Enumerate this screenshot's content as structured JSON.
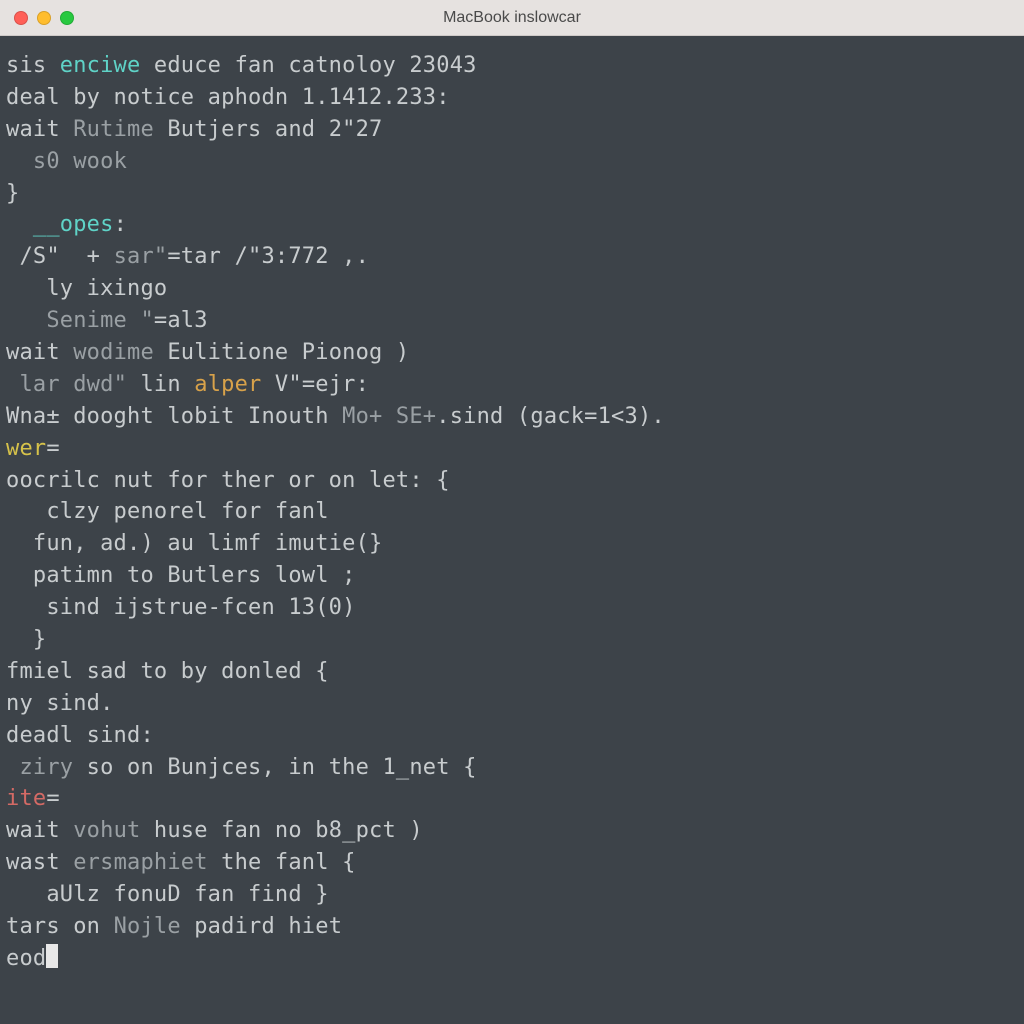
{
  "window": {
    "title": "MacBook inslowcar"
  },
  "terminal": {
    "lines": [
      {
        "indent": 0,
        "spans": [
          {
            "t": "sis ",
            "c": ""
          },
          {
            "t": "enciwe",
            "c": "c-cyan"
          },
          {
            "t": " educe fan catnoloy 23043",
            "c": ""
          }
        ]
      },
      {
        "indent": 0,
        "spans": [
          {
            "t": "deal",
            "c": ""
          },
          {
            "t": " by notice aphodn 1.1412.233:",
            "c": ""
          }
        ]
      },
      {
        "indent": 0,
        "spans": [
          {
            "t": "wait ",
            "c": ""
          },
          {
            "t": "Rutime",
            "c": "c-dim"
          },
          {
            "t": " Butjers and 2\"27",
            "c": ""
          }
        ]
      },
      {
        "indent": 1,
        "spans": [
          {
            "t": "s0 ",
            "c": "c-dim"
          },
          {
            "t": "wook",
            "c": "c-dim"
          }
        ]
      },
      {
        "indent": 0,
        "spans": [
          {
            "t": "}",
            "c": ""
          }
        ]
      },
      {
        "indent": 0,
        "spans": [
          {
            "t": "",
            "c": ""
          }
        ]
      },
      {
        "indent": 1,
        "spans": [
          {
            "t": "__opes",
            "c": "c-cyan"
          },
          {
            "t": ":",
            "c": ""
          }
        ]
      },
      {
        "indent": 0,
        "spans": [
          {
            "t": " /S\"  + ",
            "c": ""
          },
          {
            "t": "sar\"",
            "c": "c-dim"
          },
          {
            "t": "=tar /\"3:772 ,.",
            "c": ""
          }
        ]
      },
      {
        "indent": 1,
        "spans": [
          {
            "t": " ly ixingo",
            "c": ""
          }
        ]
      },
      {
        "indent": 1,
        "spans": [
          {
            "t": " Senime \"",
            "c": "c-dim"
          },
          {
            "t": "=al3",
            "c": ""
          }
        ]
      },
      {
        "indent": 0,
        "spans": [
          {
            "t": "wait ",
            "c": ""
          },
          {
            "t": "wodime",
            "c": "c-dim"
          },
          {
            "t": " Eulitione Pionog )",
            "c": ""
          }
        ]
      },
      {
        "indent": 0,
        "spans": [
          {
            "t": " lar ",
            "c": "c-dim"
          },
          {
            "t": "dwd\"",
            "c": "c-dim"
          },
          {
            "t": " lin ",
            "c": ""
          },
          {
            "t": "alper",
            "c": "c-orange"
          },
          {
            "t": " V\"=ejr:",
            "c": ""
          }
        ]
      },
      {
        "indent": 0,
        "spans": [
          {
            "t": "Wna± dooght lobit Inouth ",
            "c": ""
          },
          {
            "t": "Mo+ SE+",
            "c": "c-dim"
          },
          {
            "t": ".sind (gack=1<3).",
            "c": ""
          }
        ]
      },
      {
        "indent": 0,
        "spans": [
          {
            "t": "",
            "c": ""
          }
        ]
      },
      {
        "indent": 0,
        "spans": [
          {
            "t": "wer",
            "c": "c-yellow"
          },
          {
            "t": "=",
            "c": ""
          }
        ]
      },
      {
        "indent": 0,
        "spans": [
          {
            "t": "oocrilc nut for ther or on let: {",
            "c": ""
          }
        ]
      },
      {
        "indent": 1,
        "spans": [
          {
            "t": " clzy penorel for fanl",
            "c": ""
          }
        ]
      },
      {
        "indent": 1,
        "spans": [
          {
            "t": "fun, ad.) au limf imutie(}",
            "c": ""
          }
        ]
      },
      {
        "indent": 1,
        "spans": [
          {
            "t": "patimn to Butlers lowl ;",
            "c": ""
          }
        ]
      },
      {
        "indent": 1,
        "spans": [
          {
            "t": " sind ijstrue-fcen 13(0)",
            "c": ""
          }
        ]
      },
      {
        "indent": 1,
        "spans": [
          {
            "t": "}",
            "c": ""
          }
        ]
      },
      {
        "indent": 0,
        "spans": [
          {
            "t": "fmiel sad to by donled {",
            "c": ""
          }
        ]
      },
      {
        "indent": 0,
        "spans": [
          {
            "t": "ny sind.",
            "c": ""
          }
        ]
      },
      {
        "indent": 0,
        "spans": [
          {
            "t": "deadl sind:",
            "c": ""
          }
        ]
      },
      {
        "indent": 0,
        "spans": [
          {
            "t": " ",
            "c": ""
          },
          {
            "t": "ziry",
            "c": "c-dim"
          },
          {
            "t": " so on Bunjces, in the 1_net {",
            "c": ""
          }
        ]
      },
      {
        "indent": 0,
        "spans": [
          {
            "t": "",
            "c": ""
          }
        ]
      },
      {
        "indent": 0,
        "spans": [
          {
            "t": "ite",
            "c": "c-red"
          },
          {
            "t": "=",
            "c": ""
          }
        ]
      },
      {
        "indent": 0,
        "spans": [
          {
            "t": "wait ",
            "c": ""
          },
          {
            "t": "vohut",
            "c": "c-dim"
          },
          {
            "t": " huse fan no b8_pct )",
            "c": ""
          }
        ]
      },
      {
        "indent": 0,
        "spans": [
          {
            "t": "wast ",
            "c": ""
          },
          {
            "t": "ersmaphiet",
            "c": "c-dim"
          },
          {
            "t": " the fanl {",
            "c": ""
          }
        ]
      },
      {
        "indent": 1,
        "spans": [
          {
            "t": " aUlz fonuD fan find }",
            "c": ""
          }
        ]
      },
      {
        "indent": 0,
        "spans": [
          {
            "t": "",
            "c": ""
          }
        ]
      },
      {
        "indent": 0,
        "spans": [
          {
            "t": "tars on ",
            "c": ""
          },
          {
            "t": "Nojle",
            "c": "c-dim"
          },
          {
            "t": " padird hiet",
            "c": ""
          }
        ]
      },
      {
        "indent": 0,
        "spans": [
          {
            "t": "eod",
            "c": ""
          }
        ],
        "cursor": true
      }
    ]
  }
}
